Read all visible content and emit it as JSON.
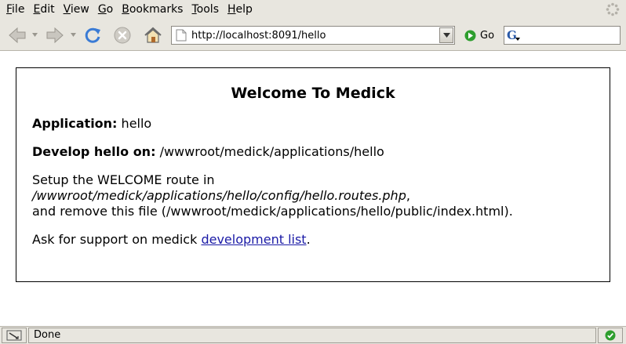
{
  "menubar": {
    "items": [
      {
        "accel": "F",
        "rest": "ile"
      },
      {
        "accel": "E",
        "rest": "dit"
      },
      {
        "accel": "V",
        "rest": "iew"
      },
      {
        "accel": "G",
        "rest": "o"
      },
      {
        "accel": "B",
        "rest": "ookmarks"
      },
      {
        "accel": "T",
        "rest": "ools"
      },
      {
        "accel": "H",
        "rest": "elp"
      }
    ]
  },
  "toolbar": {
    "url": "http://localhost:8091/hello",
    "go_label": "Go",
    "search_engine_glyph": "G",
    "search_value": ""
  },
  "page": {
    "title": "Welcome To Medick",
    "application_label": "Application:",
    "application_value": "hello",
    "develop_label": "Develop hello on:",
    "develop_value": "/wwwroot/medick/applications/hello",
    "setup_line1": "Setup the WELCOME route in",
    "setup_path": "/wwwroot/medick/applications/hello/config/hello.routes.php",
    "setup_comma": ",",
    "setup_line3": "and remove this file (/wwwroot/medick/applications/hello/public/index.html).",
    "support_text": "Ask for support on medick",
    "support_link": "development list",
    "support_end": "."
  },
  "statusbar": {
    "text": "Done"
  },
  "colors": {
    "chrome": "#e8e6df",
    "link": "#1a1aa6",
    "reload_blue": "#3a7bd5",
    "go_green": "#2e9e2e"
  },
  "icons": [
    "back-icon",
    "forward-icon",
    "reload-icon",
    "stop-icon",
    "home-icon",
    "page-icon",
    "go-icon",
    "throbber-icon",
    "connection-icon",
    "security-ok-icon"
  ]
}
